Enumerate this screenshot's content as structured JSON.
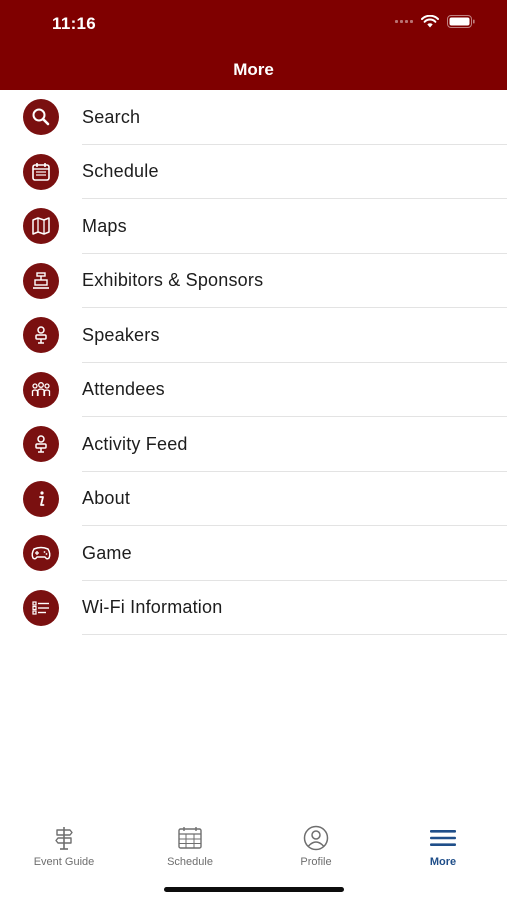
{
  "status_bar": {
    "time": "11:16"
  },
  "header": {
    "title": "More"
  },
  "menu": {
    "items": [
      {
        "label": "Search",
        "icon": "search-icon"
      },
      {
        "label": "Schedule",
        "icon": "calendar-icon"
      },
      {
        "label": "Maps",
        "icon": "map-icon"
      },
      {
        "label": "Exhibitors & Sponsors",
        "icon": "booth-icon"
      },
      {
        "label": "Speakers",
        "icon": "speaker-icon"
      },
      {
        "label": "Attendees",
        "icon": "attendees-icon"
      },
      {
        "label": "Activity Feed",
        "icon": "activity-icon"
      },
      {
        "label": "About",
        "icon": "info-icon"
      },
      {
        "label": "Game",
        "icon": "gamepad-icon"
      },
      {
        "label": "Wi-Fi Information",
        "icon": "list-icon"
      }
    ]
  },
  "tab_bar": {
    "tabs": [
      {
        "label": "Event Guide",
        "icon": "signpost-icon"
      },
      {
        "label": "Schedule",
        "icon": "calendar-icon"
      },
      {
        "label": "Profile",
        "icon": "profile-icon"
      },
      {
        "label": "More",
        "icon": "hamburger-icon"
      }
    ],
    "active": "More"
  },
  "colors": {
    "header_bg": "#7f0000",
    "icon_bg": "#7a1010",
    "active_tab": "#1f4e89",
    "inactive_tab": "#6e6e6e"
  }
}
